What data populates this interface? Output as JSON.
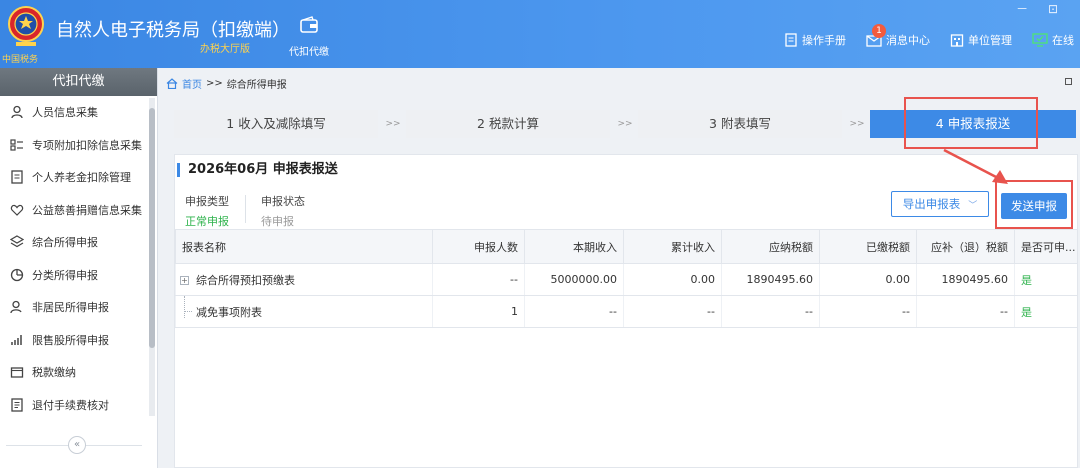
{
  "header": {
    "emblem_text": "中国税务",
    "title": "自然人电子税务局（扣缴端）",
    "subtitle": "办税大厅版",
    "tool_label": "代扣代缴",
    "window_controls": "－ ⊡",
    "items": [
      {
        "label": "操作手册",
        "icon": "manual-icon"
      },
      {
        "label": "消息中心",
        "icon": "message-icon",
        "badge": "1"
      },
      {
        "label": "单位管理",
        "icon": "company-icon"
      },
      {
        "label": "在线",
        "icon": "online-icon"
      }
    ]
  },
  "sidebar": {
    "title": "代扣代缴",
    "collapse": "«",
    "items": [
      {
        "label": "人员信息采集",
        "icon": "person-icon"
      },
      {
        "label": "专项附加扣除信息采集",
        "icon": "list-icon"
      },
      {
        "label": "个人养老金扣除管理",
        "icon": "pension-icon"
      },
      {
        "label": "公益慈善捐赠信息采集",
        "icon": "charity-icon"
      },
      {
        "label": "综合所得申报",
        "icon": "layers-icon"
      },
      {
        "label": "分类所得申报",
        "icon": "pie-icon"
      },
      {
        "label": "非居民所得申报",
        "icon": "nonresident-icon"
      },
      {
        "label": "限售股所得申报",
        "icon": "chart-icon"
      },
      {
        "label": "税款缴纳",
        "icon": "folder-icon"
      },
      {
        "label": "退付手续费核对",
        "icon": "document-icon"
      }
    ]
  },
  "breadcrumb": {
    "home": "首页",
    "sep": ">>",
    "current": "综合所得申报"
  },
  "steps": [
    {
      "label": "1 收入及减除填写",
      "active": false
    },
    {
      "label": "2 税款计算",
      "active": false
    },
    {
      "label": "3 附表填写",
      "active": false
    },
    {
      "label": "4 申报表报送",
      "active": true
    }
  ],
  "step_sep": ">>",
  "panel": {
    "title": "2026年06月  申报表报送",
    "meta": [
      {
        "key": "申报类型",
        "value": "正常申报",
        "color": "#2fb34d"
      },
      {
        "key": "申报状态",
        "value": "待申报",
        "color": "#999999"
      }
    ],
    "export_label": "导出申报表",
    "export_chevron": "﹀",
    "send_label": "发送申报"
  },
  "table": {
    "headers": [
      "报表名称",
      "申报人数",
      "本期收入",
      "累计收入",
      "应纳税额",
      "已缴税额",
      "应补（退）税额",
      "是否可申..."
    ],
    "rows": [
      {
        "expander": "+",
        "name": "综合所得预扣预缴表",
        "cells": [
          "--",
          "5000000.00",
          "0.00",
          "1890495.60",
          "0.00",
          "1890495.60",
          "是"
        ]
      },
      {
        "expander": "",
        "name": "减免事项附表",
        "cells": [
          "1",
          "--",
          "--",
          "--",
          "--",
          "--",
          "是"
        ]
      }
    ]
  },
  "colors": {
    "header_blue": "#4d98ef",
    "accent_blue": "#3d8ae6",
    "highlight_red": "#e8534d",
    "yes_green": "#2fb34d"
  }
}
